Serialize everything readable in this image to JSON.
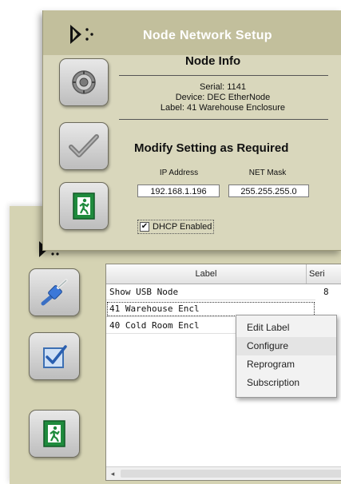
{
  "setup_window": {
    "title": "Node Network Setup",
    "node_info": {
      "heading": "Node Info",
      "serial": "Serial: 1141",
      "device": "Device: DEC EtherNode",
      "label": "Label: 41 Warehouse Enclosure"
    },
    "modify": {
      "heading": "Modify Setting as Required",
      "ip_label": "IP Address",
      "ip_value": "192.168.1.196",
      "mask_label": "NET Mask",
      "mask_value": "255.255.255.0",
      "dhcp_label": "DHCP Enabled",
      "dhcp_checked": "✔"
    }
  },
  "node_table": {
    "columns": [
      "Label",
      "Seri"
    ],
    "rows": [
      {
        "label": "Show USB Node",
        "serial": "8"
      },
      {
        "label": "41 Warehouse Encl",
        "serial": ""
      },
      {
        "label": "40 Cold Room Encl",
        "serial": ""
      }
    ]
  },
  "context_menu": {
    "items": [
      "Edit Label",
      "Configure",
      "Reprogram",
      "Subscription"
    ],
    "highlighted": "Configure"
  },
  "scroll_left_glyph": "◂",
  "icons": {
    "setup_logo": "node-logo-icon",
    "settings": "gear-icon",
    "confirm": "checkmark-icon",
    "exit": "exit-door-icon",
    "usb": "usb-plug-icon",
    "check_box": "checkbox-icon"
  }
}
